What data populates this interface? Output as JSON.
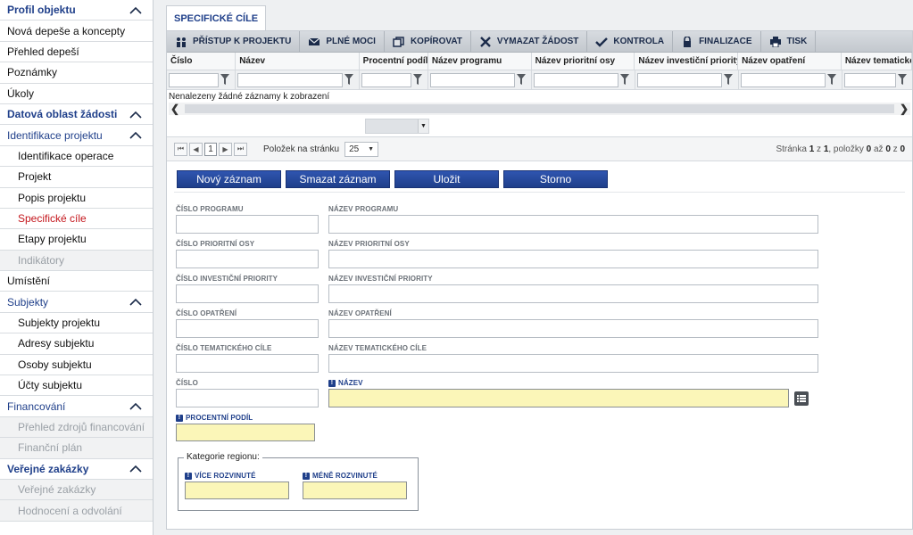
{
  "sidebar": {
    "items": [
      {
        "label": "Profil objektu",
        "type": "section",
        "chevron": true
      },
      {
        "label": "Nová depeše a koncepty",
        "type": "item"
      },
      {
        "label": "Přehled depeší",
        "type": "item"
      },
      {
        "label": "Poznámky",
        "type": "item"
      },
      {
        "label": "Úkoly",
        "type": "item"
      },
      {
        "label": "Datová oblast žádosti",
        "type": "section",
        "chevron": true
      },
      {
        "label": "Identifikace projektu",
        "type": "group",
        "chevron": true
      },
      {
        "label": "Identifikace operace",
        "type": "sub"
      },
      {
        "label": "Projekt",
        "type": "sub"
      },
      {
        "label": "Popis projektu",
        "type": "sub"
      },
      {
        "label": "Specifické cíle",
        "type": "sub",
        "state": "active"
      },
      {
        "label": "Etapy projektu",
        "type": "sub"
      },
      {
        "label": "Indikátory",
        "type": "sub",
        "state": "disabled"
      },
      {
        "label": "Umístění",
        "type": "item"
      },
      {
        "label": "Subjekty",
        "type": "group",
        "chevron": true
      },
      {
        "label": "Subjekty projektu",
        "type": "sub"
      },
      {
        "label": "Adresy subjektu",
        "type": "sub"
      },
      {
        "label": "Osoby subjektu",
        "type": "sub"
      },
      {
        "label": "Účty subjektu",
        "type": "sub"
      },
      {
        "label": "Financování",
        "type": "group",
        "chevron": true
      },
      {
        "label": "Přehled zdrojů financování",
        "type": "sub",
        "state": "disabled"
      },
      {
        "label": "Finanční plán",
        "type": "sub",
        "state": "disabled"
      },
      {
        "label": "Veřejné zakázky",
        "type": "section",
        "chevron": true
      },
      {
        "label": "Veřejné zakázky",
        "type": "sub",
        "state": "disabled"
      },
      {
        "label": "Hodnocení a odvolání",
        "type": "sub",
        "state": "disabled"
      }
    ]
  },
  "tab": {
    "label": "SPECIFICKÉ CÍLE"
  },
  "toolbar": [
    {
      "label": "PŘÍSTUP K PROJEKTU",
      "icon": "people-icon"
    },
    {
      "label": "PLNÉ MOCI",
      "icon": "envelope-icon"
    },
    {
      "label": "KOPÍROVAT",
      "icon": "copy-icon"
    },
    {
      "label": "VYMAZAT ŽÁDOST",
      "icon": "x-icon"
    },
    {
      "label": "KONTROLA",
      "icon": "check-icon"
    },
    {
      "label": "FINALIZACE",
      "icon": "lock-icon"
    },
    {
      "label": "TISK",
      "icon": "printer-icon"
    }
  ],
  "grid": {
    "columns": [
      "Číslo",
      "Název",
      "Procentní podíl",
      "Název programu",
      "Název prioritní osy",
      "Název investiční priority",
      "Název opatření",
      "Název tematického"
    ],
    "empty_text": "Nenalezeny žádné záznamy k zobrazení"
  },
  "pager": {
    "current_page": "1",
    "per_page_label": "Položek na stránku",
    "per_page": "25",
    "info_prefix": "Stránka",
    "page": "1",
    "of_word": "z",
    "pages": "1",
    "items_word": ", položky",
    "from": "0",
    "to_word": "až",
    "to": "0",
    "total": "0"
  },
  "actions": {
    "new": "Nový záznam",
    "delete": "Smazat záznam",
    "save": "Uložit",
    "cancel": "Storno"
  },
  "form": {
    "cislo_programu": "ČÍSLO PROGRAMU",
    "nazev_programu": "NÁZEV PROGRAMU",
    "cislo_prioritni_osy": "ČÍSLO PRIORITNÍ OSY",
    "nazev_prioritni_osy": "NÁZEV PRIORITNÍ OSY",
    "cislo_investicni_priority": "ČÍSLO INVESTIČNÍ PRIORITY",
    "nazev_investicni_priority": "NÁZEV INVESTIČNÍ PRIORITY",
    "cislo_opatreni": "ČÍSLO OPATŘENÍ",
    "nazev_opatreni": "NÁZEV OPATŘENÍ",
    "cislo_tematickeho_cile": "ČÍSLO TEMATICKÉHO CÍLE",
    "nazev_tematickeho_cile": "NÁZEV TEMATICKÉHO CÍLE",
    "cislo": "ČÍSLO",
    "nazev": "NÁZEV",
    "procentni_podil": "PROCENTNÍ PODÍL",
    "kategorie_regionu": "Kategorie regionu:",
    "vice_rozvinute": "VÍCE ROZVINUTÉ",
    "mene_rozvinute": "MÉNĚ ROZVINUTÉ"
  },
  "colors": {
    "accent": "#1f3f8a",
    "active_link": "#c4161c",
    "required_bg": "#fbf6b8"
  }
}
